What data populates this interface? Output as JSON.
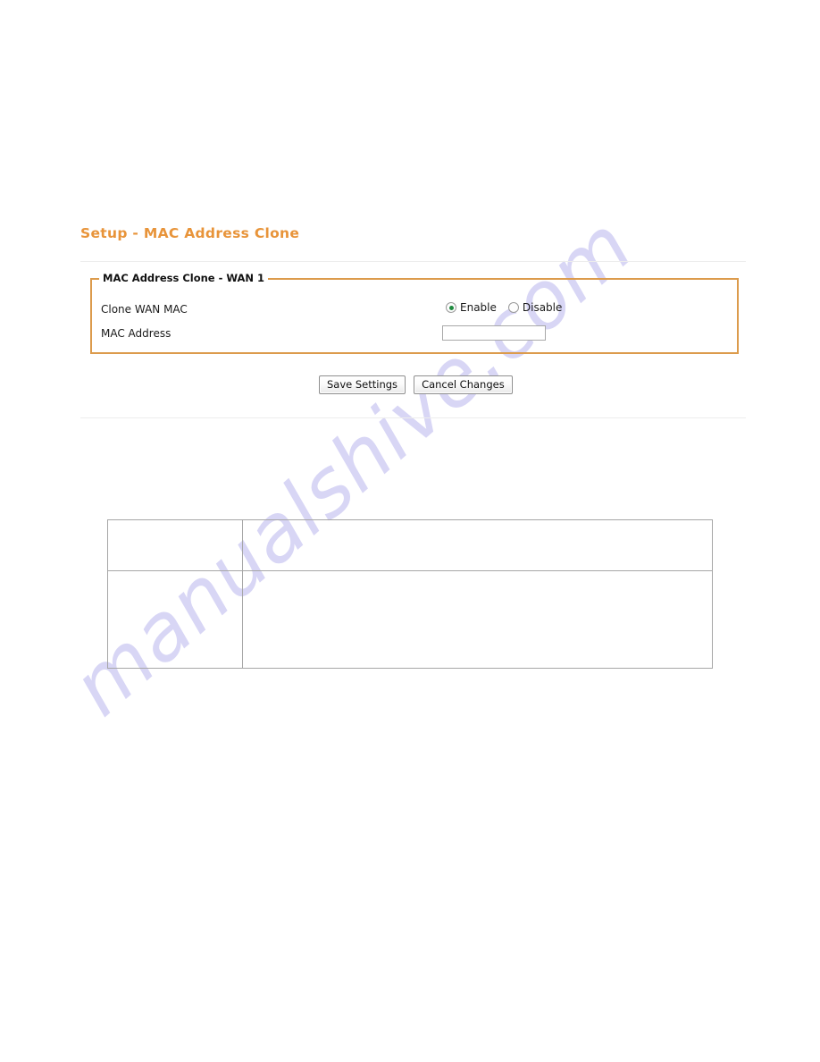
{
  "page": {
    "title": "Setup - MAC Address Clone",
    "accent_color": "#e8943a",
    "panel_border_color": "#dc9b4c",
    "divider_color": "#ededed"
  },
  "watermark": {
    "text": "manualshive.com",
    "color": "#d6d4f5"
  },
  "panel": {
    "legend": "MAC Address Clone - WAN 1",
    "fields": {
      "clone_wan_mac": {
        "label": "Clone WAN MAC",
        "options": [
          {
            "label": "Enable",
            "selected": true
          },
          {
            "label": "Disable",
            "selected": false
          }
        ],
        "selected_color": "#1f8a3f"
      },
      "mac_address": {
        "label": "MAC Address",
        "value": "",
        "placeholder": ""
      }
    }
  },
  "buttons": {
    "save": "Save Settings",
    "cancel": "Cancel Changes"
  },
  "description_table": {
    "rows": [
      {
        "key": "",
        "value": ""
      },
      {
        "key": "",
        "value": ""
      }
    ]
  }
}
